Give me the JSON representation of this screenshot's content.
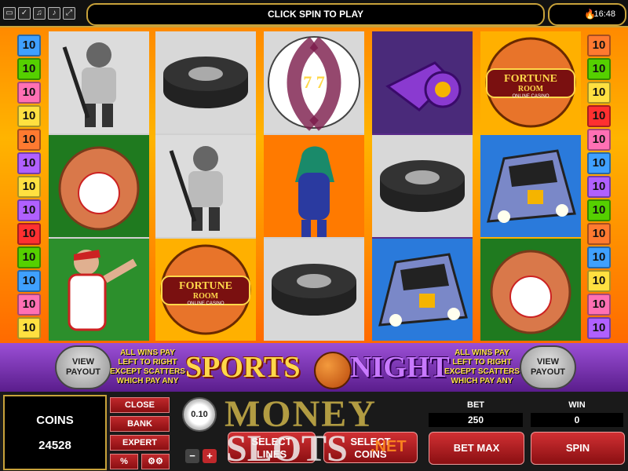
{
  "topbar": {
    "message": "CLICK SPIN TO PLAY",
    "time": "16:48",
    "icons": [
      "window-icon",
      "check-icon",
      "music-icon",
      "sound-icon",
      "fullscreen-icon"
    ]
  },
  "line_numbers_left": [
    "10",
    "10",
    "10",
    "10",
    "10",
    "10",
    "10",
    "10",
    "10",
    "10",
    "10",
    "10",
    "10"
  ],
  "line_numbers_right": [
    "10",
    "10",
    "10",
    "10",
    "10",
    "10",
    "10",
    "10",
    "10",
    "10",
    "10",
    "10",
    "10"
  ],
  "line_colors_left": [
    "#3fa0ff",
    "#55d000",
    "#ff70b4",
    "#ffe040",
    "#ff7a30",
    "#b060ff",
    "#ffe040",
    "#b060ff",
    "#ff3030",
    "#55d000",
    "#3fa0ff",
    "#ff70b4",
    "#ffe040"
  ],
  "line_colors_right": [
    "#ff7a30",
    "#55d000",
    "#ffe040",
    "#ff3030",
    "#ff70b4",
    "#3fa0ff",
    "#b060ff",
    "#55d000",
    "#ff7a30",
    "#3fa0ff",
    "#ffe040",
    "#ff70b4",
    "#b060ff"
  ],
  "reels": [
    [
      "hockey-player",
      "baseball-glove",
      "baseball-pitcher"
    ],
    [
      "hockey-puck",
      "hockey-player",
      "fortune-room-basketball"
    ],
    [
      "soccer-ball",
      "racing-girl",
      "hockey-puck"
    ],
    [
      "whistle",
      "hockey-puck",
      "race-car"
    ],
    [
      "fortune-room-basketball",
      "race-car",
      "baseball-glove"
    ]
  ],
  "symbols_text": {
    "fortune_line1": "FORTUNE",
    "fortune_line2": "ROOM",
    "fortune_line3": "ONLINE CASINO",
    "soccer_sevens": "7  7"
  },
  "banner": {
    "view_payout_left": "VIEW\nPAYOUT",
    "view_payout_right": "VIEW\nPAYOUT",
    "wins_text_left": "ALL WINS PAY\nLEFT TO RIGHT\nEXCEPT SCATTERS\nWHICH PAY ANY",
    "wins_text_right": "ALL WINS PAY\nLEFT TO RIGHT\nEXCEPT SCATTERS\nWHICH PAY ANY",
    "logo_word1": "SPORTS",
    "logo_word2": "NIGHT"
  },
  "controls": {
    "coins_label": "COINS",
    "coins_value": "24528",
    "close": "CLOSE",
    "bank": "BANK",
    "expert": "EXPERT",
    "percent": "%",
    "settings_icon": "gears-icon",
    "coin_size": "0.10",
    "minus": "−",
    "plus": "+",
    "select_lines": "SELECT\nLINES",
    "select_coins": "SELECT\nCOINS",
    "bet_label": "BET",
    "bet_value": "250",
    "win_label": "WIN",
    "win_value": "0",
    "bet_max": "BET MAX",
    "spin": "SPIN"
  },
  "watermark": {
    "line1": "MONEY",
    "line2": "SLOTS",
    "line3": ".NET"
  },
  "colors": {
    "accent_gold": "#c8a23a",
    "button_red": "#c0282b",
    "banner_purple": "#7a33b8",
    "background_orange": "#ff8a00"
  }
}
